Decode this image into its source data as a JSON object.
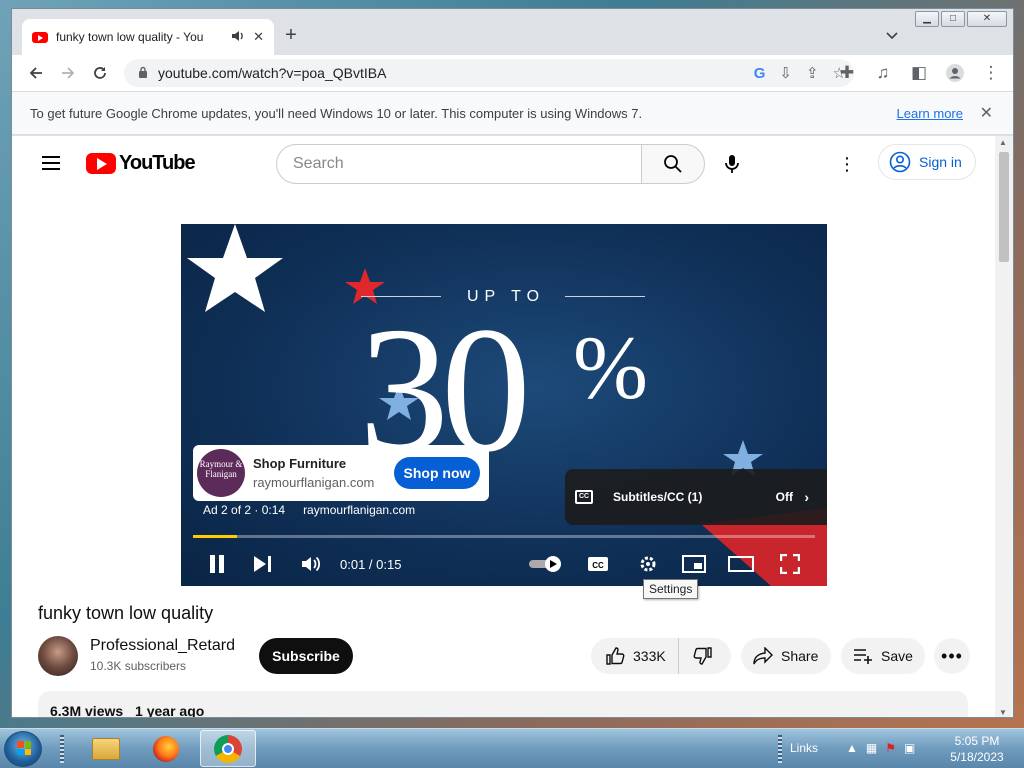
{
  "browser": {
    "tab_title": "funky town low quality - You",
    "url": "youtube.com/watch?v=poa_QBvtIBA",
    "infobar_text": "To get future Google Chrome updates, you'll need Windows 10 or later. This computer is using Windows 7.",
    "infobar_link": "Learn more"
  },
  "youtube": {
    "logo_text": "YouTube",
    "search_placeholder": "Search",
    "signin_label": "Sign in"
  },
  "ad": {
    "upto_text": "UP TO",
    "big_number": "30",
    "percent_text": "%",
    "advertiser_logo_text": "Raymour & Flanigan",
    "card_title": "Shop Furniture",
    "card_url": "raymourflanigan.com",
    "shop_button": "Shop now",
    "ad_counter": "Ad 2 of 2 · 0:14",
    "ad_link": "raymourflanigan.com"
  },
  "player": {
    "subtitles_label": "Subtitles/CC (1)",
    "subtitles_value": "Off",
    "current_time": "0:01 / 0:15",
    "progress_percent": 7,
    "settings_tooltip": "Settings"
  },
  "video": {
    "title": "funky town low quality",
    "channel_name": "Professional_Retard",
    "channel_subs": "10.3K subscribers",
    "subscribe_label": "Subscribe",
    "likes": "333K",
    "share_label": "Share",
    "save_label": "Save",
    "views": "6.3M views",
    "age": "1 year ago"
  },
  "taskbar": {
    "links_label": "Links",
    "time": "5:05 PM",
    "date": "5/18/2023"
  },
  "colors": {
    "yt_red": "#ff0000",
    "link_blue": "#065fd4",
    "progress_yellow": "#ffcc00"
  }
}
